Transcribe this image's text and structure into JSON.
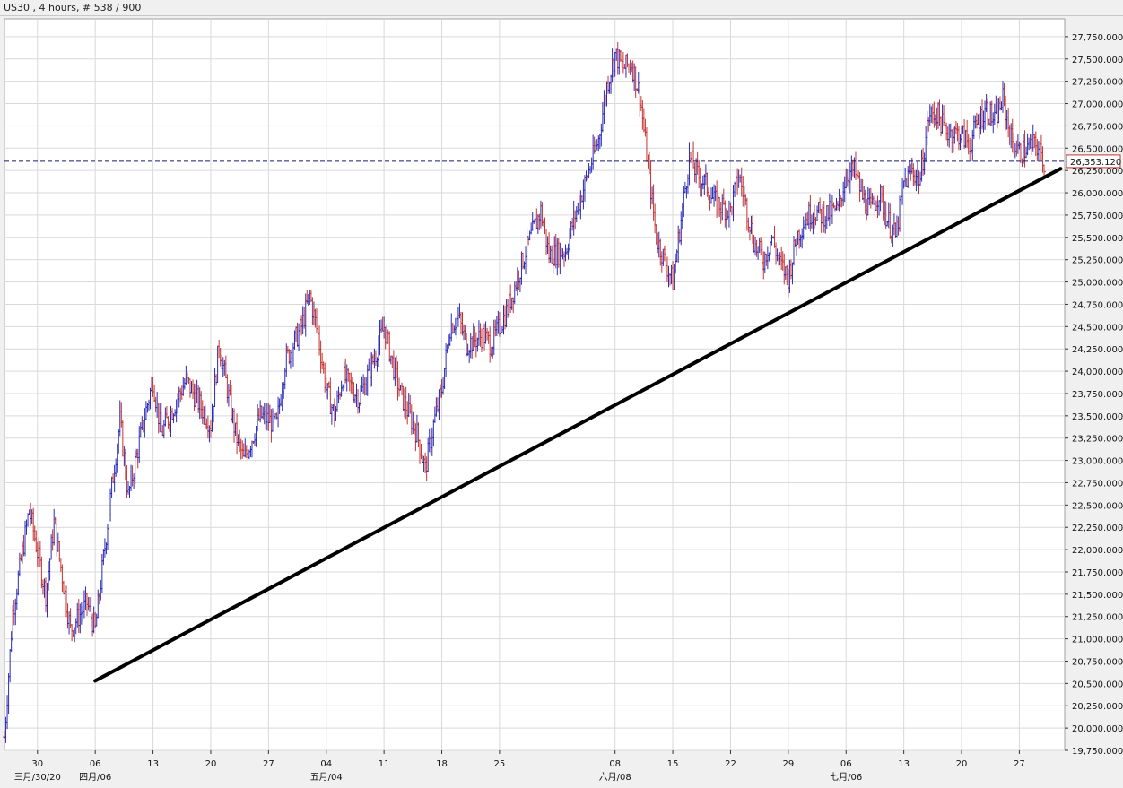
{
  "window": {
    "title": "US30 , 4 hours, # 538 / 900"
  },
  "colors": {
    "up_bar": "#2b2bb8",
    "down_bar": "#c83232",
    "grid": "#d9d9d9",
    "price_line": "#1a1a6a",
    "price_label_border": "#c83232",
    "trendline": "#000000"
  },
  "current_price_label": "26,353.120",
  "chart_data": {
    "type": "ohlc",
    "symbol": "US30",
    "timeframe": "4 hours",
    "ylim": [
      19750,
      27950
    ],
    "y_ticks": [
      "19,750.000",
      "20,000.000",
      "20,250.000",
      "20,500.000",
      "20,750.000",
      "21,000.000",
      "21,250.000",
      "21,500.000",
      "21,750.000",
      "22,000.000",
      "22,250.000",
      "22,500.000",
      "22,750.000",
      "23,000.000",
      "23,250.000",
      "23,500.000",
      "23,750.000",
      "24,000.000",
      "24,250.000",
      "24,500.000",
      "24,750.000",
      "25,000.000",
      "25,250.000",
      "25,500.000",
      "25,750.000",
      "26,000.000",
      "26,250.000",
      "26,500.000",
      "26,750.000",
      "27,000.000",
      "27,250.000",
      "27,500.000",
      "27,750.000"
    ],
    "x_ticks": [
      {
        "label": "30",
        "date": "2020-03-30"
      },
      {
        "label": "06",
        "date": "2020-04-06"
      },
      {
        "label": "13",
        "date": "2020-04-13"
      },
      {
        "label": "20",
        "date": "2020-04-20"
      },
      {
        "label": "27",
        "date": "2020-04-27"
      },
      {
        "label": "04",
        "date": "2020-05-04"
      },
      {
        "label": "11",
        "date": "2020-05-11"
      },
      {
        "label": "18",
        "date": "2020-05-18"
      },
      {
        "label": "25",
        "date": "2020-05-25"
      },
      {
        "label": "08",
        "date": "2020-06-08"
      },
      {
        "label": "15",
        "date": "2020-06-15"
      },
      {
        "label": "22",
        "date": "2020-06-22"
      },
      {
        "label": "29",
        "date": "2020-06-29"
      },
      {
        "label": "06",
        "date": "2020-07-06"
      },
      {
        "label": "13",
        "date": "2020-07-13"
      },
      {
        "label": "20",
        "date": "2020-07-20"
      },
      {
        "label": "27",
        "date": "2020-07-27"
      }
    ],
    "month_labels": [
      {
        "label": "三月/30/20",
        "date": "2020-03-30"
      },
      {
        "label": "四月/06",
        "date": "2020-04-06"
      },
      {
        "label": "五月/04",
        "date": "2020-05-04"
      },
      {
        "label": "六月/08",
        "date": "2020-06-08"
      },
      {
        "label": "七月/06",
        "date": "2020-07-06"
      }
    ],
    "last_price": 26353.12,
    "trendline": {
      "start": {
        "date": "2020-04-06",
        "price": 20530
      },
      "end": {
        "date": "2020-08-01",
        "price": 26270
      }
    },
    "price_path": [
      {
        "date": "2020-03-26",
        "price": 19900
      },
      {
        "date": "2020-03-27",
        "price": 21300
      },
      {
        "date": "2020-03-29",
        "price": 22450
      },
      {
        "date": "2020-03-31",
        "price": 21500
      },
      {
        "date": "2020-04-01",
        "price": 22300
      },
      {
        "date": "2020-04-03",
        "price": 21100
      },
      {
        "date": "2020-04-05",
        "price": 21400
      },
      {
        "date": "2020-04-06",
        "price": 21100
      },
      {
        "date": "2020-04-07",
        "price": 21900
      },
      {
        "date": "2020-04-08",
        "price": 22700
      },
      {
        "date": "2020-04-09",
        "price": 23450
      },
      {
        "date": "2020-04-10",
        "price": 22600
      },
      {
        "date": "2020-04-12",
        "price": 23500
      },
      {
        "date": "2020-04-13",
        "price": 23900
      },
      {
        "date": "2020-04-14",
        "price": 23300
      },
      {
        "date": "2020-04-16",
        "price": 23700
      },
      {
        "date": "2020-04-17",
        "price": 23900
      },
      {
        "date": "2020-04-20",
        "price": 23400
      },
      {
        "date": "2020-04-21",
        "price": 24300
      },
      {
        "date": "2020-04-22",
        "price": 23800
      },
      {
        "date": "2020-04-23",
        "price": 23300
      },
      {
        "date": "2020-04-24",
        "price": 23000
      },
      {
        "date": "2020-04-26",
        "price": 23500
      },
      {
        "date": "2020-04-28",
        "price": 23400
      },
      {
        "date": "2020-04-29",
        "price": 24100
      },
      {
        "date": "2020-05-01",
        "price": 24500
      },
      {
        "date": "2020-05-02",
        "price": 24850
      },
      {
        "date": "2020-05-03",
        "price": 24400
      },
      {
        "date": "2020-05-04",
        "price": 23800
      },
      {
        "date": "2020-05-05",
        "price": 23500
      },
      {
        "date": "2020-05-06",
        "price": 23950
      },
      {
        "date": "2020-05-08",
        "price": 23700
      },
      {
        "date": "2020-05-10",
        "price": 24200
      },
      {
        "date": "2020-05-11",
        "price": 24500
      },
      {
        "date": "2020-05-12",
        "price": 24100
      },
      {
        "date": "2020-05-13",
        "price": 23750
      },
      {
        "date": "2020-05-15",
        "price": 23300
      },
      {
        "date": "2020-05-16",
        "price": 22900
      },
      {
        "date": "2020-05-17",
        "price": 23400
      },
      {
        "date": "2020-05-18",
        "price": 23800
      },
      {
        "date": "2020-05-19",
        "price": 24500
      },
      {
        "date": "2020-05-20",
        "price": 24600
      },
      {
        "date": "2020-05-21",
        "price": 24300
      },
      {
        "date": "2020-05-23",
        "price": 24400
      },
      {
        "date": "2020-05-24",
        "price": 24300
      },
      {
        "date": "2020-05-26",
        "price": 24700
      },
      {
        "date": "2020-05-27",
        "price": 25000
      },
      {
        "date": "2020-05-28",
        "price": 25300
      },
      {
        "date": "2020-05-30",
        "price": 25800
      },
      {
        "date": "2020-05-31",
        "price": 25300
      },
      {
        "date": "2020-06-02",
        "price": 25350
      },
      {
        "date": "2020-06-03",
        "price": 25700
      },
      {
        "date": "2020-06-04",
        "price": 26000
      },
      {
        "date": "2020-06-05",
        "price": 26300
      },
      {
        "date": "2020-06-06",
        "price": 26600
      },
      {
        "date": "2020-06-07",
        "price": 27200
      },
      {
        "date": "2020-06-08",
        "price": 27550
      },
      {
        "date": "2020-06-09",
        "price": 27400
      },
      {
        "date": "2020-06-10",
        "price": 27450
      },
      {
        "date": "2020-06-11",
        "price": 27100
      },
      {
        "date": "2020-06-12",
        "price": 26300
      },
      {
        "date": "2020-06-13",
        "price": 25500
      },
      {
        "date": "2020-06-14",
        "price": 25250
      },
      {
        "date": "2020-06-15",
        "price": 25000
      },
      {
        "date": "2020-06-16",
        "price": 25700
      },
      {
        "date": "2020-06-17",
        "price": 26400
      },
      {
        "date": "2020-06-18",
        "price": 26200
      },
      {
        "date": "2020-06-19",
        "price": 26100
      },
      {
        "date": "2020-06-20",
        "price": 25900
      },
      {
        "date": "2020-06-22",
        "price": 25800
      },
      {
        "date": "2020-06-23",
        "price": 26200
      },
      {
        "date": "2020-06-24",
        "price": 25800
      },
      {
        "date": "2020-06-25",
        "price": 25400
      },
      {
        "date": "2020-06-26",
        "price": 25250
      },
      {
        "date": "2020-06-27",
        "price": 25500
      },
      {
        "date": "2020-06-28",
        "price": 25200
      },
      {
        "date": "2020-06-29",
        "price": 25050
      },
      {
        "date": "2020-06-30",
        "price": 25500
      },
      {
        "date": "2020-07-01",
        "price": 25700
      },
      {
        "date": "2020-07-02",
        "price": 25800
      },
      {
        "date": "2020-07-03",
        "price": 25750
      },
      {
        "date": "2020-07-05",
        "price": 25800
      },
      {
        "date": "2020-07-06",
        "price": 26200
      },
      {
        "date": "2020-07-07",
        "price": 26250
      },
      {
        "date": "2020-07-08",
        "price": 25950
      },
      {
        "date": "2020-07-09",
        "price": 25800
      },
      {
        "date": "2020-07-10",
        "price": 26000
      },
      {
        "date": "2020-07-11",
        "price": 25700
      },
      {
        "date": "2020-07-12",
        "price": 25500
      },
      {
        "date": "2020-07-13",
        "price": 26100
      },
      {
        "date": "2020-07-14",
        "price": 26250
      },
      {
        "date": "2020-07-15",
        "price": 26150
      },
      {
        "date": "2020-07-16",
        "price": 26850
      },
      {
        "date": "2020-07-17",
        "price": 26900
      },
      {
        "date": "2020-07-18",
        "price": 26700
      },
      {
        "date": "2020-07-20",
        "price": 26650
      },
      {
        "date": "2020-07-21",
        "price": 26550
      },
      {
        "date": "2020-07-22",
        "price": 26800
      },
      {
        "date": "2020-07-23",
        "price": 26950
      },
      {
        "date": "2020-07-24",
        "price": 26800
      },
      {
        "date": "2020-07-25",
        "price": 27050
      },
      {
        "date": "2020-07-26",
        "price": 26600
      },
      {
        "date": "2020-07-27",
        "price": 26450
      },
      {
        "date": "2020-07-28",
        "price": 26500
      },
      {
        "date": "2020-07-29",
        "price": 26550
      },
      {
        "date": "2020-07-30",
        "price": 26350
      }
    ]
  }
}
